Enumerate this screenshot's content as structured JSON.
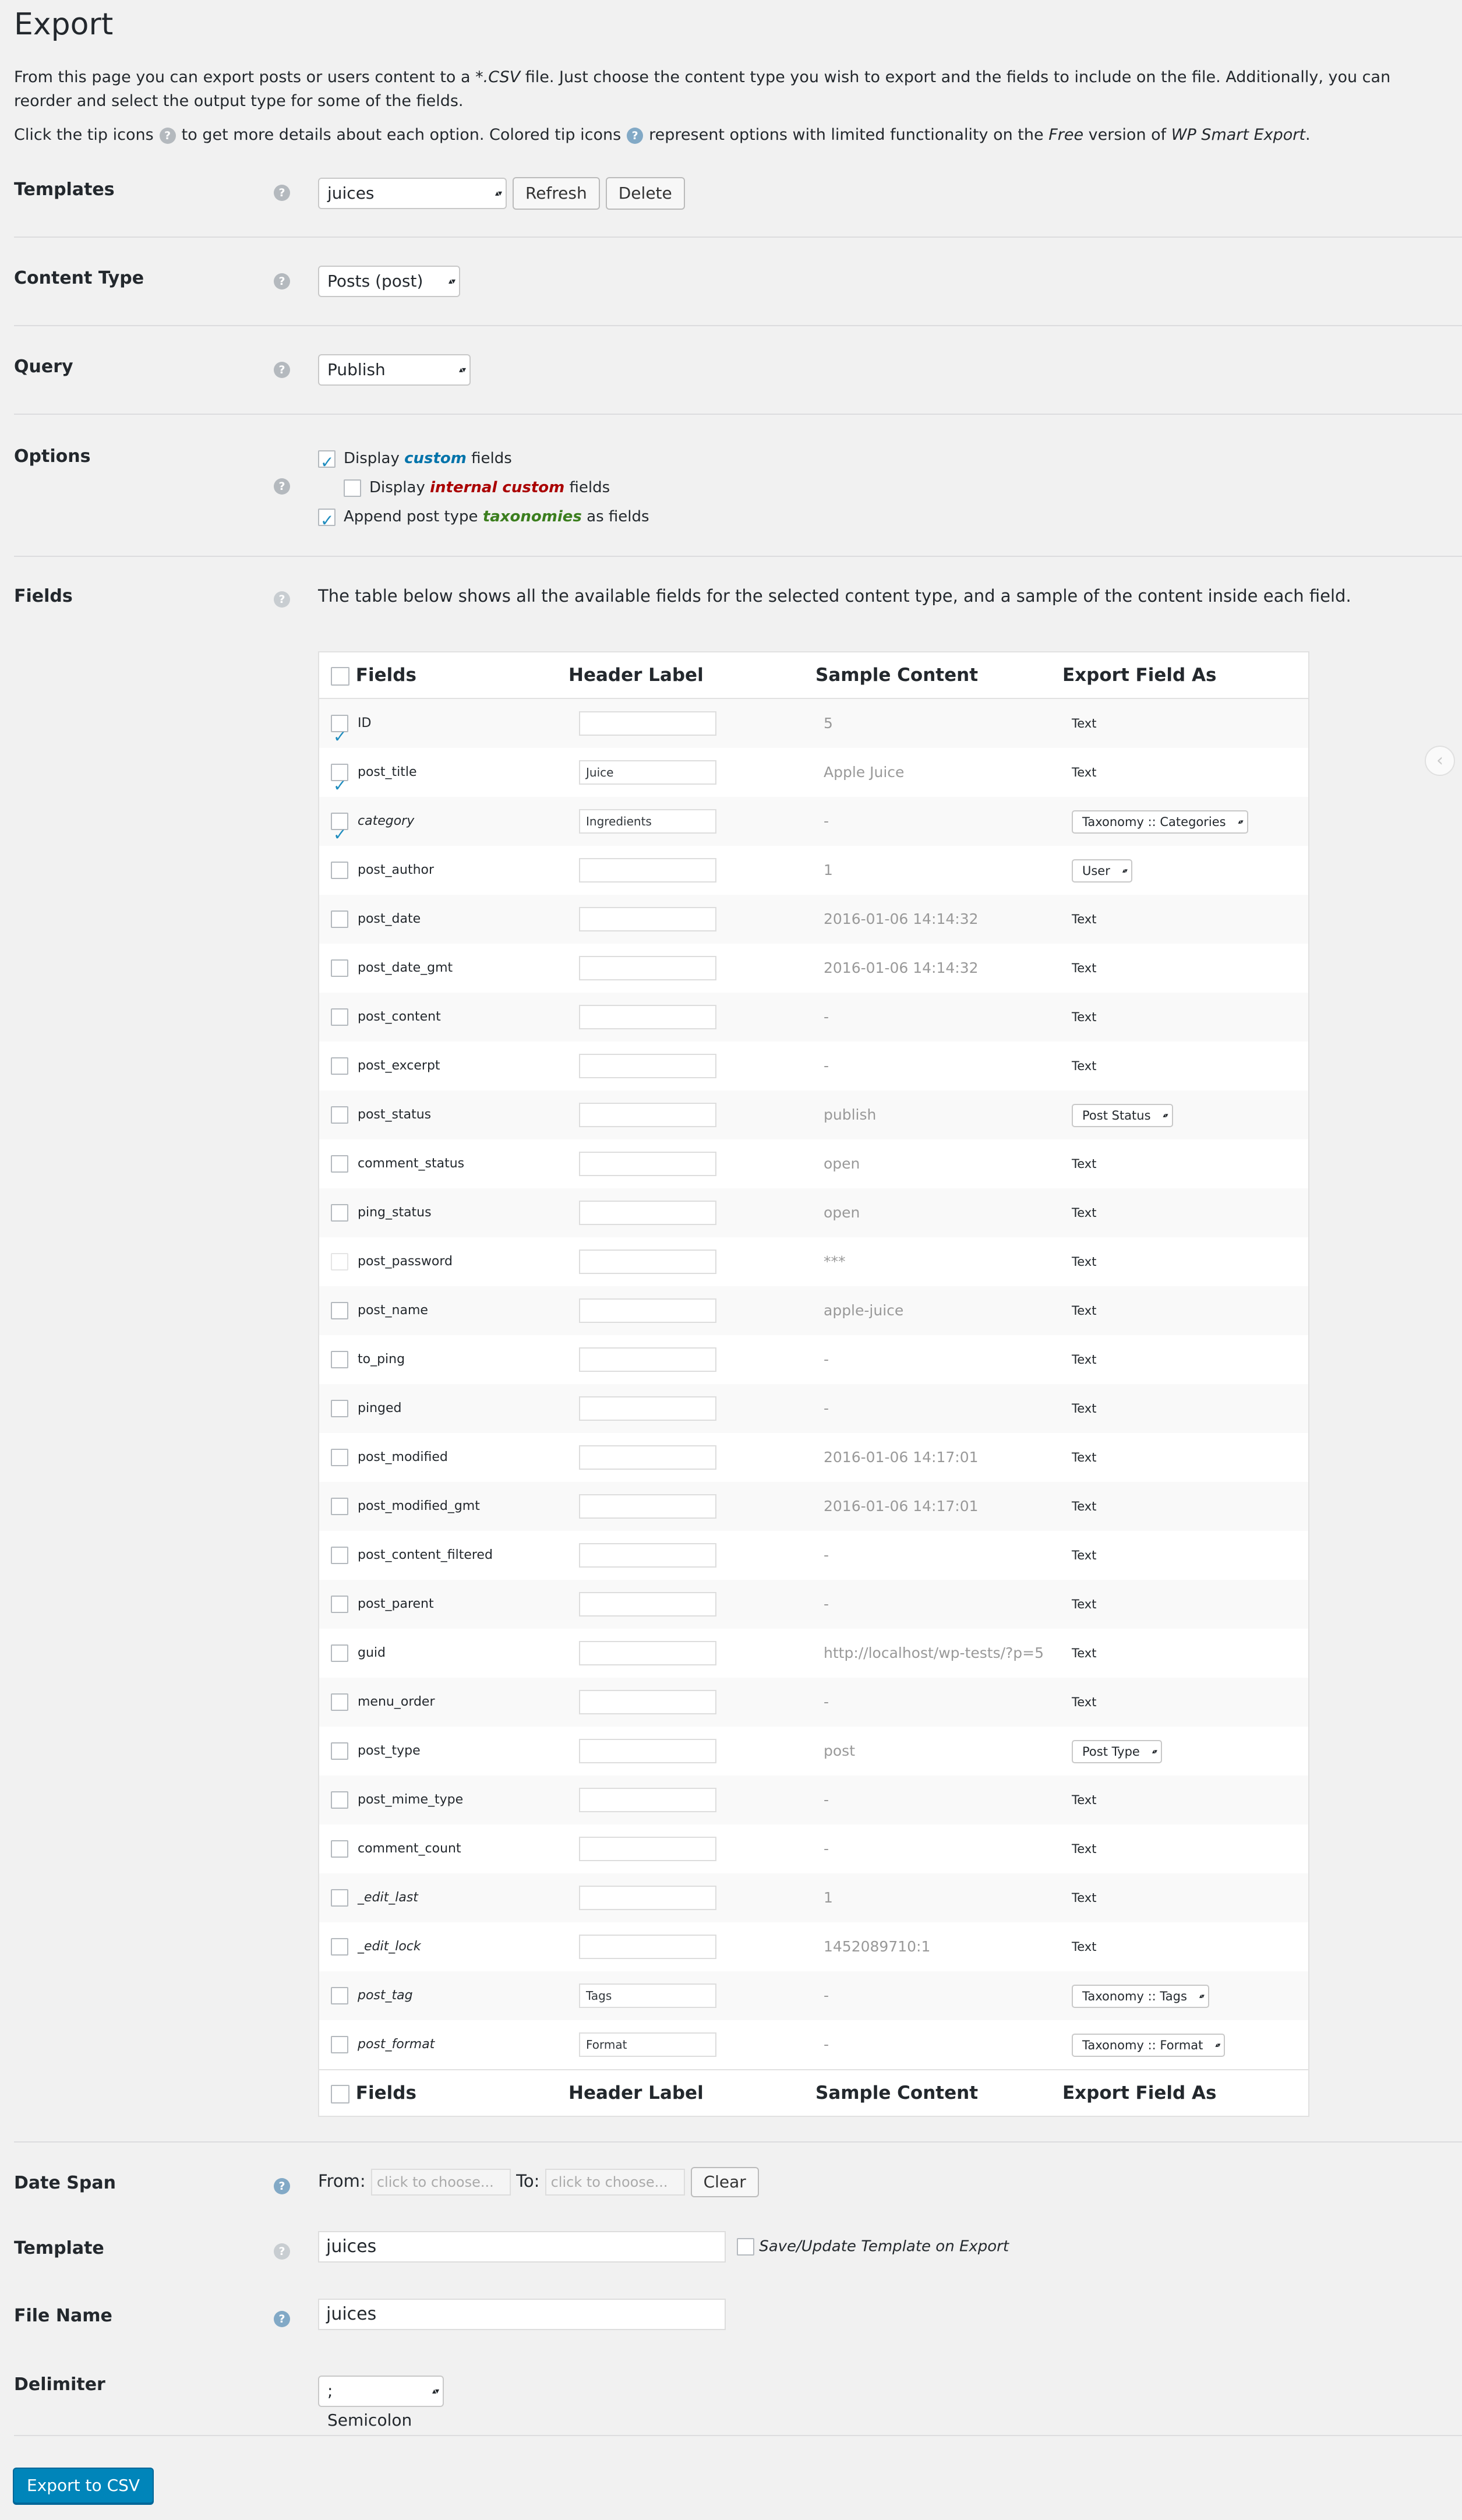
{
  "page": {
    "title": "Export",
    "intro_line_a": "From this page you can export posts or users content to a ",
    "intro_csv": "*.CSV",
    "intro_line_b": " file. Just choose the content type you wish to export and the fields to include on the file. Additionally, you can reorder and select the output type for some of the fields.",
    "tips_a": "Click the tip icons",
    "tips_b": "to get more details about each option. Colored tip icons",
    "tips_c": "represent options with limited functionality on the",
    "tips_free": "Free",
    "tips_d": "version of",
    "tips_product": "WP Smart Export",
    "tips_e": "."
  },
  "templates": {
    "label": "Templates",
    "selected": "juices",
    "refresh_label": "Refresh",
    "delete_label": "Delete"
  },
  "content_type": {
    "label": "Content Type",
    "selected": "Posts (post)"
  },
  "query": {
    "label": "Query",
    "selected": "Publish"
  },
  "options": {
    "label": "Options",
    "display_custom": {
      "pre": "Display",
      "em": "custom",
      "post": "fields",
      "checked": true
    },
    "display_internal": {
      "pre": "Display",
      "em": "internal custom",
      "post": "fields",
      "checked": false
    },
    "append_tax": {
      "pre": "Append post type",
      "em": "taxonomies",
      "post": "as fields",
      "checked": true
    }
  },
  "fields": {
    "label": "Fields",
    "description": "The table below shows all the available fields for the selected content type, and a sample of the content inside each field.",
    "columns": [
      "Fields",
      "Header Label",
      "Sample Content",
      "Export Field As"
    ],
    "rows": [
      {
        "name": "ID",
        "checked": true,
        "style": "normal",
        "header": "",
        "sample": "5",
        "export": "Text",
        "select": false
      },
      {
        "name": "post_title",
        "checked": true,
        "style": "normal",
        "header": "Juice",
        "sample": "Apple Juice",
        "export": "Text",
        "select": false
      },
      {
        "name": "category",
        "checked": true,
        "style": "green",
        "header": "Ingredients",
        "sample": "-",
        "export": "Taxonomy :: Categories",
        "select": true
      },
      {
        "name": "post_author",
        "checked": false,
        "style": "normal",
        "header": "",
        "sample": "1",
        "export": "User",
        "select": true
      },
      {
        "name": "post_date",
        "checked": false,
        "style": "normal",
        "header": "",
        "sample": "2016-01-06 14:14:32",
        "export": "Text",
        "select": false
      },
      {
        "name": "post_date_gmt",
        "checked": false,
        "style": "normal",
        "header": "",
        "sample": "2016-01-06 14:14:32",
        "export": "Text",
        "select": false
      },
      {
        "name": "post_content",
        "checked": false,
        "style": "normal",
        "header": "",
        "sample": "-",
        "export": "Text",
        "select": false
      },
      {
        "name": "post_excerpt",
        "checked": false,
        "style": "normal",
        "header": "",
        "sample": "-",
        "export": "Text",
        "select": false
      },
      {
        "name": "post_status",
        "checked": false,
        "style": "normal",
        "header": "",
        "sample": "publish",
        "export": "Post Status",
        "select": true
      },
      {
        "name": "comment_status",
        "checked": false,
        "style": "normal",
        "header": "",
        "sample": "open",
        "export": "Text",
        "select": false
      },
      {
        "name": "ping_status",
        "checked": false,
        "style": "normal",
        "header": "",
        "sample": "open",
        "export": "Text",
        "select": false
      },
      {
        "name": "post_password",
        "checked": false,
        "style": "faint",
        "header": "",
        "sample": "***",
        "export": "Text",
        "select": false
      },
      {
        "name": "post_name",
        "checked": false,
        "style": "normal",
        "header": "",
        "sample": "apple-juice",
        "export": "Text",
        "select": false
      },
      {
        "name": "to_ping",
        "checked": false,
        "style": "normal",
        "header": "",
        "sample": "-",
        "export": "Text",
        "select": false
      },
      {
        "name": "pinged",
        "checked": false,
        "style": "normal",
        "header": "",
        "sample": "-",
        "export": "Text",
        "select": false
      },
      {
        "name": "post_modified",
        "checked": false,
        "style": "normal",
        "header": "",
        "sample": "2016-01-06 14:17:01",
        "export": "Text",
        "select": false
      },
      {
        "name": "post_modified_gmt",
        "checked": false,
        "style": "normal",
        "header": "",
        "sample": "2016-01-06 14:17:01",
        "export": "Text",
        "select": false
      },
      {
        "name": "post_content_filtered",
        "checked": false,
        "style": "normal",
        "header": "",
        "sample": "-",
        "export": "Text",
        "select": false
      },
      {
        "name": "post_parent",
        "checked": false,
        "style": "normal",
        "header": "",
        "sample": "-",
        "export": "Text",
        "select": false
      },
      {
        "name": "guid",
        "checked": false,
        "style": "normal",
        "header": "",
        "sample": "http://localhost/wp-tests/?p=5",
        "export": "Text",
        "select": false
      },
      {
        "name": "menu_order",
        "checked": false,
        "style": "normal",
        "header": "",
        "sample": "-",
        "export": "Text",
        "select": false
      },
      {
        "name": "post_type",
        "checked": false,
        "style": "normal",
        "header": "",
        "sample": "post",
        "export": "Post Type",
        "select": true
      },
      {
        "name": "post_mime_type",
        "checked": false,
        "style": "normal",
        "header": "",
        "sample": "-",
        "export": "Text",
        "select": false
      },
      {
        "name": "comment_count",
        "checked": false,
        "style": "normal",
        "header": "",
        "sample": "-",
        "export": "Text",
        "select": false
      },
      {
        "name": "_edit_last",
        "checked": false,
        "style": "red",
        "header": "",
        "sample": "1",
        "export": "Text",
        "select": false
      },
      {
        "name": "_edit_lock",
        "checked": false,
        "style": "red",
        "header": "",
        "sample": "1452089710:1",
        "export": "Text",
        "select": false
      },
      {
        "name": "post_tag",
        "checked": false,
        "style": "green",
        "header": "Tags",
        "sample": "-",
        "export": "Taxonomy :: Tags",
        "select": true
      },
      {
        "name": "post_format",
        "checked": false,
        "style": "green",
        "header": "Format",
        "sample": "-",
        "export": "Taxonomy :: Format",
        "select": true
      }
    ]
  },
  "date_span": {
    "label": "Date Span",
    "from_label": "From:",
    "to_label": "To:",
    "from_placeholder": "click to choose...",
    "to_placeholder": "click to choose...",
    "clear_label": "Clear"
  },
  "template": {
    "label": "Template",
    "value": "juices",
    "save_label": "Save/Update Template on Export",
    "save_checked": false
  },
  "file_name": {
    "label": "File Name",
    "value": "juices"
  },
  "delimiter": {
    "label": "Delimiter",
    "selected": "; Semicolon"
  },
  "export_button": "Export to CSV",
  "tip_glyph": "?",
  "colors": {
    "accent": "#0085ba",
    "custom": "#0073aa",
    "internal": "#aa0000",
    "taxonomy": "#3b7e1e",
    "tip": "#b4b9be",
    "tip_colored": "#82a9c6"
  }
}
